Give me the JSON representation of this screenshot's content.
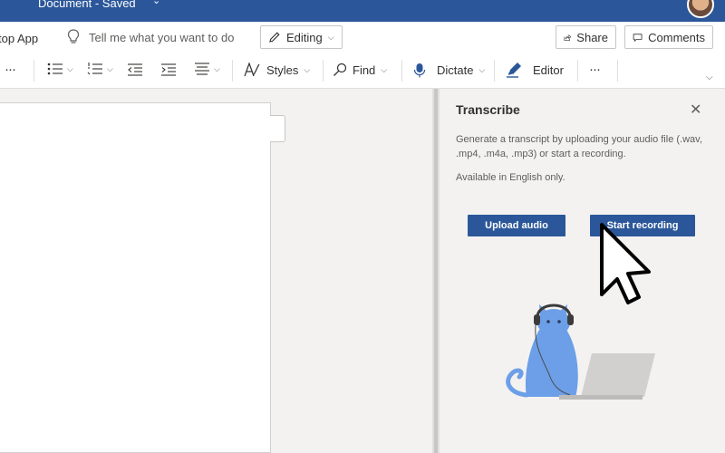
{
  "title_bar": {
    "document_title": "Document - Saved",
    "chevron_icon": "chevron-down-icon"
  },
  "command_bar": {
    "desktop_app_label": "top App",
    "tell_me_placeholder": "Tell me what you want to do",
    "editing_label": "Editing",
    "share_label": "Share",
    "comments_label": "Comments"
  },
  "ribbon": {
    "more_left": "···",
    "styles_label": "Styles",
    "find_label": "Find",
    "dictate_label": "Dictate",
    "editor_label": "Editor",
    "more_right": "···"
  },
  "transcribe_pane": {
    "title": "Transcribe",
    "description": "Generate a transcript by uploading your audio file (.wav, .mp4, .m4a, .mp3) or start a recording.",
    "note": "Available in English only.",
    "upload_label": "Upload audio",
    "record_label": "Start recording"
  },
  "colors": {
    "brand": "#2b579a",
    "pane_bg": "#f3f2f1",
    "illustration": "#6c9fe8"
  }
}
